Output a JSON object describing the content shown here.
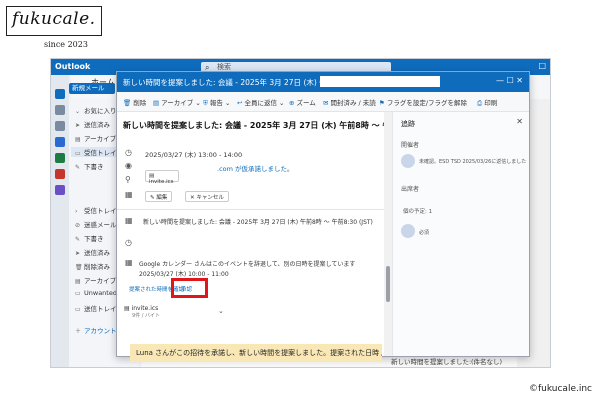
{
  "logo": {
    "text": "fukucale.",
    "since": "since 2023"
  },
  "copyright": "©fukucale.inc",
  "app": {
    "name": "Outlook",
    "search_placeholder": "検索",
    "ribbon": {
      "home_tab": "ホーム",
      "new_mail": "新規メール"
    },
    "folders": [
      {
        "label": "お気に入り"
      },
      {
        "label": "送信済み"
      },
      {
        "label": "アーカイブ"
      },
      {
        "label": "受信トレイ"
      },
      {
        "label": "下書き"
      },
      {
        "label": "受信トレイ"
      },
      {
        "label": "迷惑メール"
      },
      {
        "label": "下書き"
      },
      {
        "label": "送信済み"
      },
      {
        "label": "削除済み"
      },
      {
        "label": "アーカイブ"
      },
      {
        "label": "Unwanted"
      },
      {
        "label": "送信トレイ"
      }
    ],
    "account_label": "アカウント",
    "bottom_tabs": [
      "新しい時間を提案しました: ...",
      "(件名なし)",
      "(件名なし)"
    ]
  },
  "popup": {
    "title": "新しい時間を提案しました: 会議 - 2025年 3月 27日 (木) 午前8時 ～ 午前8:30 (JST)",
    "toolbar": {
      "delete": "削除",
      "archive": "アーカイブ",
      "report": "報告",
      "reply_all": "全員に返信",
      "zoom": "ズーム",
      "read_unread": "開封済み / 未読",
      "flag": "フラグを設定/フラグを解除",
      "print": "印刷"
    },
    "subject": "新しい時間を提案しました: 会議 - 2025年 3月 27日 (木) 午前8時 ～ 午前8:30 (JST)",
    "time_row": "2025/03/27 (木) 13:00 - 14:00",
    "accepted_text": ".com が仮承諾しました。",
    "attachment_name": "invite.ics",
    "edit_btn": "編集",
    "cancel_btn": "キャンセル",
    "proposal_header": "新しい時間を提案しました: 会議 - 2025年 3月 27日 (木) 午前8時 ～ 午前8:30 (JST)",
    "proposal_text": "Google カレンダー さんはこのイベントを辞退して、別の日時を提案しています",
    "proposal_time": "2025/03/27 (木) 10:00 - 11:00",
    "proposed_link": "提案された時間を確認",
    "accept_link": "承認",
    "attach2_name": "invite.ics",
    "attach2_size": "9件 / バイト",
    "notice": "Luna さんがこの招待を承諾し、新しい時間を提案しました。提案された日時 / メッ",
    "side": {
      "header": "追跡",
      "organizer_label": "開催者",
      "organizer_note": "未確認。ESD TSD 2025/03/26に返信しました",
      "attendees_label": "出席者",
      "required_label": "個の予定: 1",
      "attendee_status": "必須"
    }
  }
}
